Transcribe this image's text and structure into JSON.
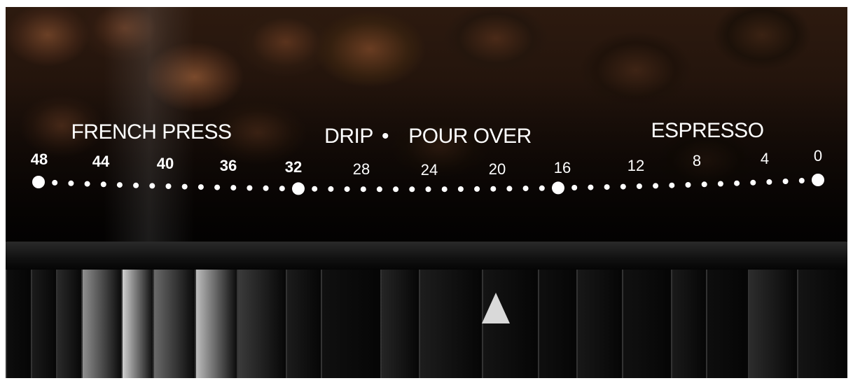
{
  "scale": {
    "zone_labels": {
      "french_press": "FRENCH PRESS",
      "drip": "DRIP",
      "separator": "•",
      "pour_over": "POUR OVER",
      "espresso": "ESPRESSO"
    },
    "numbers": [
      "48",
      "44",
      "40",
      "36",
      "32",
      "28",
      "24",
      "20",
      "16",
      "12",
      "8",
      "4",
      "0"
    ]
  },
  "colors": {
    "marking": "#ffffff",
    "pointer": "#d9d9d9",
    "ring": "#111111"
  },
  "icons": {
    "pointer": "triangle-up-icon"
  }
}
